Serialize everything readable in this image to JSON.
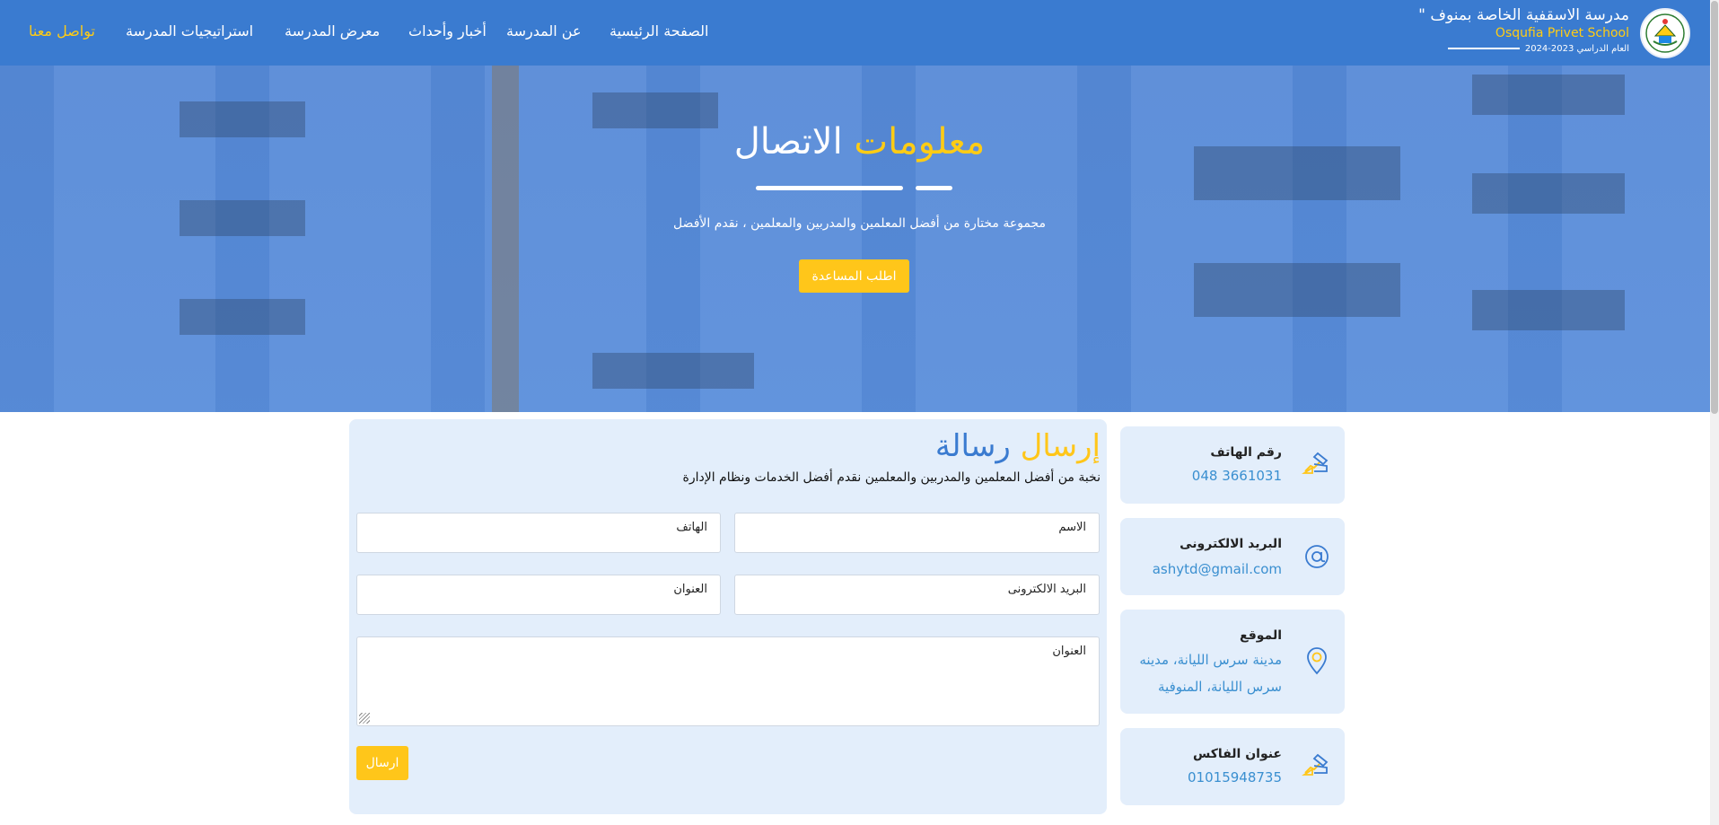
{
  "brand": {
    "name_ar": "مدرسة الاسقفية الخاصة بمنوف \"",
    "name_en": "Osqufia Privet School",
    "year": "العام الدراسي 2023-2024"
  },
  "nav": {
    "items": [
      {
        "label": "الصفحة الرئيسية"
      },
      {
        "label": "عن المدرسة"
      },
      {
        "label": "أخبار وأحداث"
      },
      {
        "label": "معرض المدرسة"
      },
      {
        "label": "استراتيجيات المدرسة"
      },
      {
        "label": "تواصل معنا",
        "active": true
      }
    ]
  },
  "hero": {
    "title_highlight": "معلومات",
    "title_rest": "الاتصال",
    "subtitle": "مجموعة مختارة من أفضل المعلمين والمدربين والمعلمين ، نقدم الأفضل",
    "help_button": "اطلب المساعدة"
  },
  "form": {
    "title_highlight": "إرسال",
    "title_rest": "رسالة",
    "description": "نخبة من أفضل المعلمين والمدربين والمعلمين نقدم أفضل الخدمات ونظام الإدارة",
    "name_placeholder": "الاسم",
    "phone_placeholder": "الهاتف",
    "email_placeholder": "البريد الالكترونى",
    "address_placeholder": "العنوان",
    "message_placeholder": "العنوان",
    "send_button": "ارسال"
  },
  "info": {
    "phone_title": "رقم الهاتف",
    "phone_value": "048 3661031",
    "email_title": "البريد الالكترونى",
    "email_value": "ashytd@gmail.com",
    "location_title": "الموقع",
    "location_value": "مدينة سرس الليانة، مدينه سرس الليانة، المنوفية",
    "fax_title": "عنوان الفاكس",
    "fax_value": "01015948735"
  },
  "colors": {
    "primary": "#3a7bd0",
    "accent": "#ffc61a",
    "card_bg": "#e3eefb"
  },
  "icons": {
    "phone": "phone-hand-icon",
    "email": "at-sign-icon",
    "location": "map-pin-icon",
    "fax": "fax-hand-icon"
  }
}
